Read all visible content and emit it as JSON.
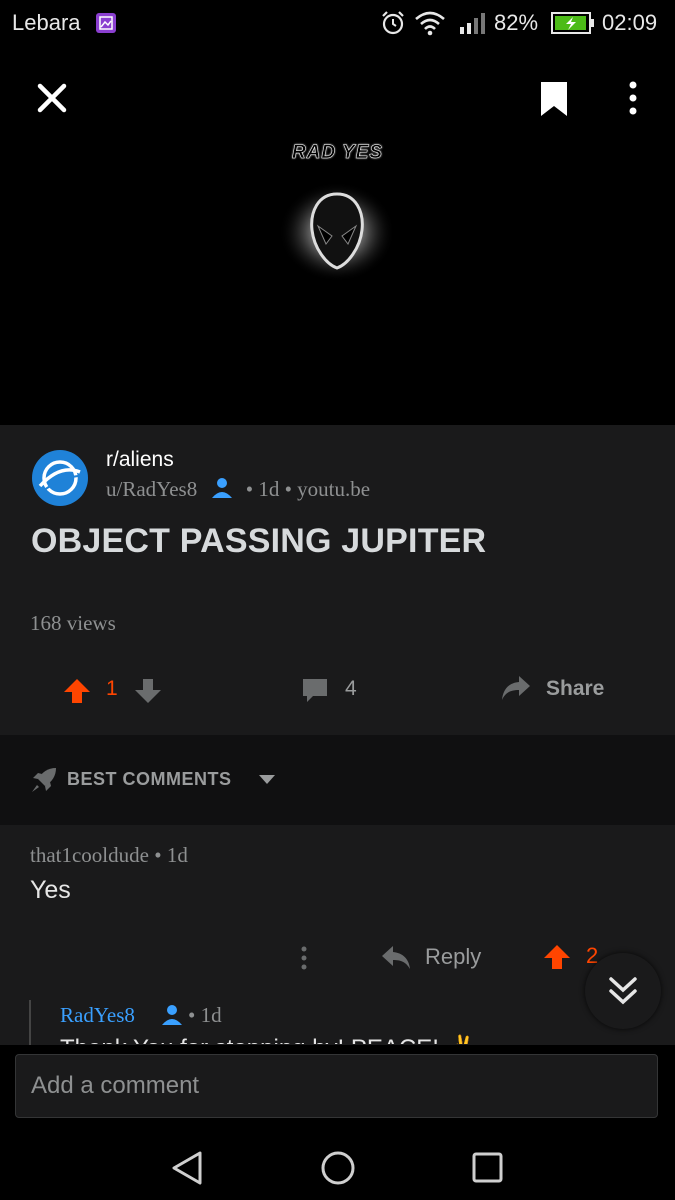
{
  "status_bar": {
    "carrier": "Lebara",
    "battery": "82%",
    "time": "02:09"
  },
  "top_bar": {
    "close_icon": "close-icon",
    "bookmark_icon": "bookmark-icon",
    "more_icon": "more-vertical-icon"
  },
  "media": {
    "logo_text": "RAD YES"
  },
  "post": {
    "subreddit": "r/aliens",
    "author": "u/RadYes8",
    "age": "• 1d",
    "domain": "• youtu.be",
    "title": "OBJECT PASSING JUPITER",
    "views": "168 views",
    "upvotes": "1",
    "comments": "4",
    "share_label": "Share"
  },
  "sort": {
    "label": "BEST COMMENTS"
  },
  "comments": [
    {
      "author": "that1cooldude",
      "age": "• 1d",
      "body": "Yes",
      "reply_label": "Reply",
      "score": "2"
    }
  ],
  "reply": {
    "author": "RadYes8",
    "age": "• 1d",
    "body_partial": "Thank You for stopping by! PEACE! ✌"
  },
  "composer": {
    "placeholder": "Add a comment"
  },
  "colors": {
    "accent_upvote": "#ff4500",
    "link_blue": "#3aa0ff",
    "avatar_blue": "#1f82d8",
    "card_bg": "#1a1a1b"
  }
}
